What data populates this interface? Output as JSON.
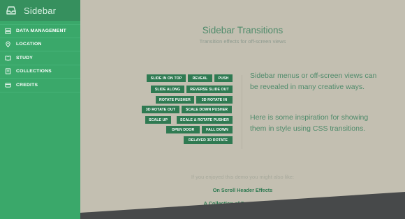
{
  "sidebar": {
    "title": "Sidebar",
    "items": [
      {
        "label": "DATA MANAGEMENT",
        "icon": "storage-icon"
      },
      {
        "label": "LOCATION",
        "icon": "location-pin-icon"
      },
      {
        "label": "STUDY",
        "icon": "study-icon"
      },
      {
        "label": "COLLECTIONS",
        "icon": "collections-icon"
      },
      {
        "label": "CREDITS",
        "icon": "credits-icon"
      }
    ]
  },
  "main": {
    "title": "Sidebar Transitions",
    "subtitle": "Transition effects for off-screen views",
    "buttons": [
      "SLIDE IN ON TOP",
      "REVEAL",
      "PUSH",
      "SLIDE ALONG",
      "REVERSE SLIDE OUT",
      "ROTATE PUSHER",
      "3D ROTATE IN",
      "3D ROTATE OUT",
      "SCALE DOWN PUSHER",
      "SCALE UP",
      "SCALE & ROTATE PUSHER",
      "OPEN DOOR",
      "FALL DOWN",
      "DELAYED 3D ROTATE"
    ],
    "description": [
      "Sidebar menus or off-screen views can be revealed in many creative ways.",
      "Here is some inspiration for showing them in style using CSS transitions."
    ]
  },
  "related": {
    "intro": "If you enjoyed this demo you might also like:",
    "links": [
      "On Scroll Header Effects",
      "A Collection of Page Transitions"
    ]
  }
}
